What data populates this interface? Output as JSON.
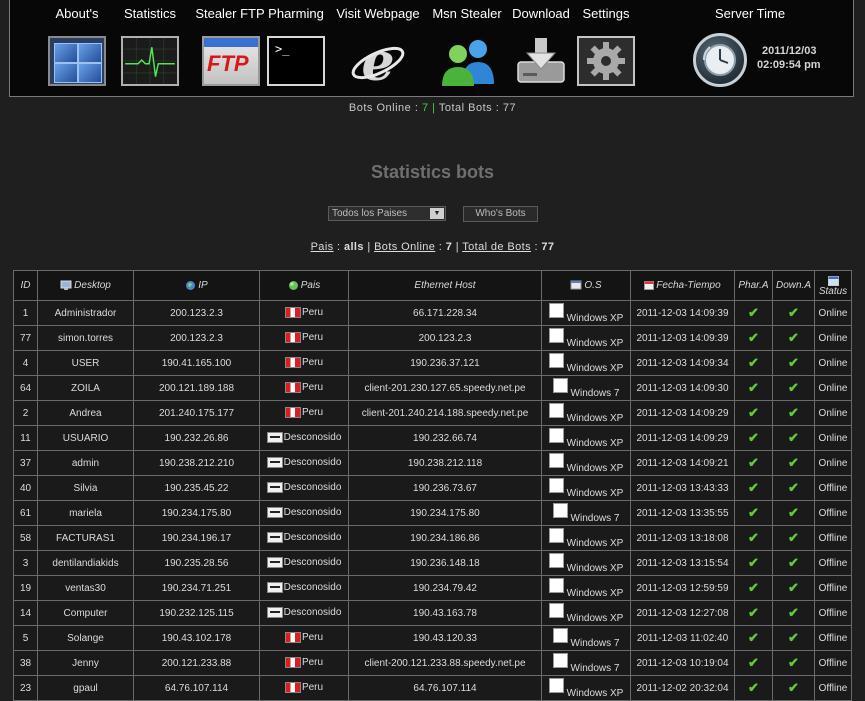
{
  "nav": {
    "items": [
      {
        "label": "About's",
        "icon": "windows-panels-icon"
      },
      {
        "label": "Statistics",
        "icon": "heartbeat-monitor-icon"
      },
      {
        "label": "Stealer FTP",
        "icon": "ftp-icon"
      },
      {
        "label": "Pharming",
        "icon": "terminal-icon"
      },
      {
        "label": "Visit Webpage",
        "icon": "internet-explorer-icon"
      },
      {
        "label": "Msn Stealer",
        "icon": "msn-buddies-icon"
      },
      {
        "label": "Download",
        "icon": "hard-drive-download-icon"
      },
      {
        "label": "Settings",
        "icon": "gear-icon"
      }
    ],
    "server_time_label": "Server Time",
    "server_date": "2011/12/03",
    "server_clock": "02:09:54 pm"
  },
  "summary": {
    "bots_online_label": "Bots Online :",
    "bots_online": "7",
    "separator": "|",
    "total_bots_label": "Total Bots :",
    "total_bots": "77"
  },
  "heading": "Statistics bots",
  "filters": {
    "country_select": "Todos los Paises",
    "whois_button": "Who's Bots"
  },
  "filter_line": {
    "pais_label": "Pais",
    "pais_value": "alls",
    "bots_online_label": "Bots Online",
    "bots_online_value": "7",
    "total_label": "Total de Bots",
    "total_value": "77"
  },
  "table": {
    "headers": {
      "id": "ID",
      "desktop": "Desktop",
      "ip": "IP",
      "pais": "Pais",
      "host": "Ethernet Host",
      "os": "O.S",
      "fecha": "Fecha-Tiempo",
      "phar": "Phar.A",
      "down": "Down.A",
      "status": "Status"
    },
    "check_glyph": "✔",
    "colors": {
      "online": "#2f9a2f",
      "offline": "#e02a2a",
      "check": "#62c83c"
    },
    "rows": [
      {
        "id": "1",
        "desktop": "Administrador",
        "ip": "200.123.2.3",
        "country": "Peru",
        "flag": "pe",
        "host": "66.171.228.34",
        "os": "Windows XP",
        "time": "2011-12-03 14:09:39",
        "status": "Online"
      },
      {
        "id": "77",
        "desktop": "simon.torres",
        "ip": "200.123.2.3",
        "country": "Peru",
        "flag": "pe",
        "host": "200.123.2.3",
        "os": "Windows XP",
        "time": "2011-12-03 14:09:39",
        "status": "Online"
      },
      {
        "id": "4",
        "desktop": "USER",
        "ip": "190.41.165.100",
        "country": "Peru",
        "flag": "pe",
        "host": "190.236.37.121",
        "os": "Windows XP",
        "time": "2011-12-03 14:09:34",
        "status": "Online"
      },
      {
        "id": "64",
        "desktop": "ZOILA",
        "ip": "200.121.189.188",
        "country": "Peru",
        "flag": "pe",
        "host": "client-201.230.127.65.speedy.net.pe",
        "os": "Windows 7",
        "time": "2011-12-03 14:09:30",
        "status": "Online"
      },
      {
        "id": "2",
        "desktop": "Andrea",
        "ip": "201.240.175.177",
        "country": "Peru",
        "flag": "pe",
        "host": "client-201.240.214.188.speedy.net.pe",
        "os": "Windows XP",
        "time": "2011-12-03 14:09:29",
        "status": "Online"
      },
      {
        "id": "11",
        "desktop": "USUARIO",
        "ip": "190.232.26.86",
        "country": "Desconosido",
        "flag": "unk",
        "host": "190.232.66.74",
        "os": "Windows XP",
        "time": "2011-12-03 14:09:29",
        "status": "Online"
      },
      {
        "id": "37",
        "desktop": "admin",
        "ip": "190.238.212.210",
        "country": "Desconosido",
        "flag": "unk",
        "host": "190.238.212.118",
        "os": "Windows XP",
        "time": "2011-12-03 14:09:21",
        "status": "Online"
      },
      {
        "id": "40",
        "desktop": "Silvia",
        "ip": "190.235.45.22",
        "country": "Desconosido",
        "flag": "unk",
        "host": "190.236.73.67",
        "os": "Windows XP",
        "time": "2011-12-03 13:43:33",
        "status": "Offline"
      },
      {
        "id": "61",
        "desktop": "mariela",
        "ip": "190.234.175.80",
        "country": "Desconosido",
        "flag": "unk",
        "host": "190.234.175.80",
        "os": "Windows 7",
        "time": "2011-12-03 13:35:55",
        "status": "Offline"
      },
      {
        "id": "58",
        "desktop": "FACTURAS1",
        "ip": "190.234.196.17",
        "country": "Desconosido",
        "flag": "unk",
        "host": "190.234.186.86",
        "os": "Windows XP",
        "time": "2011-12-03 13:18:08",
        "status": "Offline"
      },
      {
        "id": "3",
        "desktop": "dentilandiakids",
        "ip": "190.235.28.56",
        "country": "Desconosido",
        "flag": "unk",
        "host": "190.236.148.18",
        "os": "Windows XP",
        "time": "2011-12-03 13:15:54",
        "status": "Offline"
      },
      {
        "id": "19",
        "desktop": "ventas30",
        "ip": "190.234.71.251",
        "country": "Desconosido",
        "flag": "unk",
        "host": "190.234.79.42",
        "os": "Windows XP",
        "time": "2011-12-03 12:59:59",
        "status": "Offline"
      },
      {
        "id": "14",
        "desktop": "Computer",
        "ip": "190.232.125.115",
        "country": "Desconosido",
        "flag": "unk",
        "host": "190.43.163.78",
        "os": "Windows XP",
        "time": "2011-12-03 12:27:08",
        "status": "Offline"
      },
      {
        "id": "5",
        "desktop": "Solange",
        "ip": "190.43.102.178",
        "country": "Peru",
        "flag": "pe",
        "host": "190.43.120.33",
        "os": "Windows 7",
        "time": "2011-12-03 11:02:40",
        "status": "Offline"
      },
      {
        "id": "38",
        "desktop": "Jenny",
        "ip": "200.121.233.88",
        "country": "Peru",
        "flag": "pe",
        "host": "client-200.121.233.88.speedy.net.pe",
        "os": "Windows 7",
        "time": "2011-12-03 10:19:04",
        "status": "Offline"
      },
      {
        "id": "23",
        "desktop": "gpaul",
        "ip": "64.76.107.114",
        "country": "Peru",
        "flag": "pe",
        "host": "64.76.107.114",
        "os": "Windows XP",
        "time": "2011-12-02 20:32:04",
        "status": "Offline"
      }
    ]
  }
}
